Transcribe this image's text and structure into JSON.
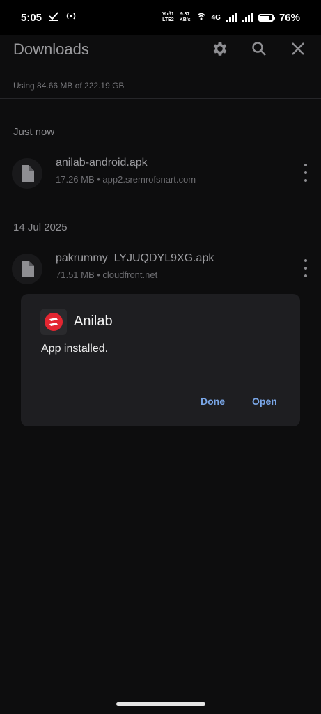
{
  "status_bar": {
    "time": "5:05",
    "volte_top": "Voß1",
    "volte_bottom": "LTE2",
    "net_speed_value": "9.37",
    "net_speed_unit": "KB/s",
    "network_type": "4G",
    "battery_percent": "76%",
    "battery_level": 0.76
  },
  "app_bar": {
    "title": "Downloads",
    "icons": [
      "gear-icon",
      "search-icon",
      "close-icon"
    ]
  },
  "storage_usage": "Using 84.66 MB of 222.19 GB",
  "sections": [
    {
      "header": "Just now",
      "files": [
        {
          "name": "anilab-android.apk",
          "meta": "17.26 MB • app2.sremrofsnart.com"
        }
      ]
    },
    {
      "header": "14 Jul 2025",
      "files": [
        {
          "name": "pakrummy_LYJUQDYL9XG.apk",
          "meta": "71.51 MB • cloudfront.net"
        }
      ]
    }
  ],
  "dialog": {
    "app_name": "Anilab",
    "message": "App installed.",
    "done_label": "Done",
    "open_label": "Open"
  },
  "colors": {
    "background": "#0d0d0e",
    "dialog": "#1e1e21",
    "accent": "#7aa7e8",
    "brand_red": "#e32631"
  }
}
